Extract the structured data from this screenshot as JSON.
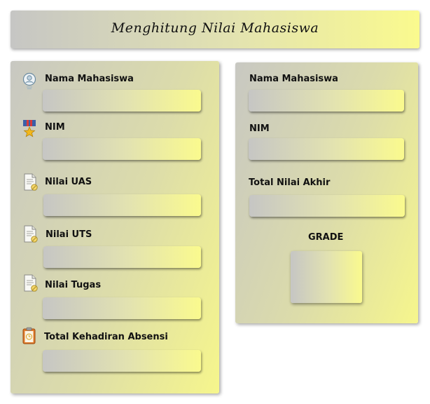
{
  "header": {
    "title": "Menghitung Nilai Mahasiswa"
  },
  "form": {
    "nama_label": "Nama Mahasiswa",
    "nama_value": "",
    "nim_label": "NIM",
    "nim_value": "",
    "uas_label": "Nilai UAS",
    "uas_value": "",
    "uts_label": "Nilai UTS",
    "uts_value": "",
    "tugas_label": "Nilai Tugas",
    "tugas_value": "",
    "absensi_label": "Total Kehadiran Absensi",
    "absensi_value": ""
  },
  "result": {
    "nama_label": "Nama Mahasiswa",
    "nama_value": "",
    "nim_label": "NIM",
    "nim_value": "",
    "total_label": "Total Nilai Akhir",
    "total_value": "",
    "grade_label": "GRADE",
    "grade_value": ""
  },
  "icons": {
    "nama": "user-icon",
    "nim": "medal-icon",
    "uas": "document-icon",
    "uts": "document-icon",
    "tugas": "document-icon",
    "absensi": "clipboard-icon"
  },
  "colors": {
    "gradient_start": "#c6c6c4",
    "gradient_end": "#fafa8e"
  }
}
